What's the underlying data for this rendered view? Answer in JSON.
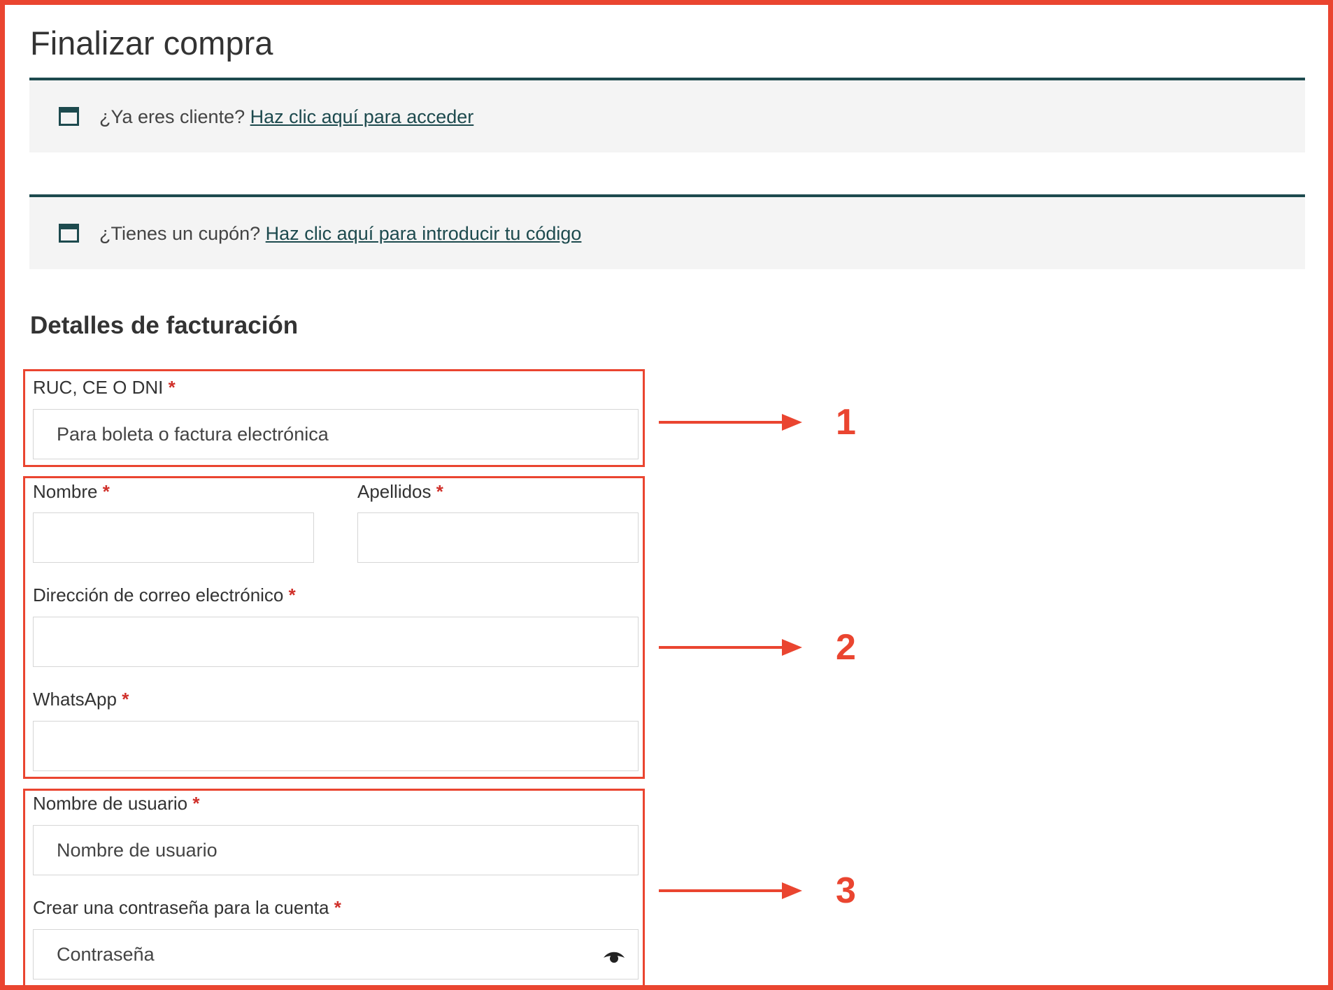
{
  "page": {
    "title": "Finalizar compra",
    "accent_color": "#EA4530",
    "notice_color": "#1d4a4e"
  },
  "notices": {
    "login": {
      "icon": "window-icon",
      "text": "¿Ya eres cliente?",
      "link": "Haz clic aquí para acceder"
    },
    "coupon": {
      "icon": "window-icon",
      "text": "¿Tienes un cupón?",
      "link": "Haz clic aquí para introducir tu código"
    }
  },
  "billing": {
    "title": "Detalles de facturación",
    "required_mark": "*",
    "fields": {
      "document": {
        "label": "RUC, CE O DNI",
        "placeholder": "Para boleta o factura electrónica",
        "value": ""
      },
      "first_name": {
        "label": "Nombre",
        "placeholder": "",
        "value": ""
      },
      "last_name": {
        "label": "Apellidos",
        "placeholder": "",
        "value": ""
      },
      "email": {
        "label": "Dirección de correo electrónico",
        "placeholder": "",
        "value": ""
      },
      "whatsapp": {
        "label": "WhatsApp",
        "placeholder": "",
        "value": ""
      },
      "username": {
        "label": "Nombre de usuario",
        "placeholder": "Nombre de usuario",
        "value": ""
      },
      "password": {
        "label": "Crear una contraseña para la cuenta",
        "placeholder": "Contraseña",
        "value": "",
        "toggle_icon": "eye-icon"
      }
    }
  },
  "annotations": {
    "steps": [
      "1",
      "2",
      "3"
    ],
    "arrow_icon": "right-arrow-icon"
  }
}
